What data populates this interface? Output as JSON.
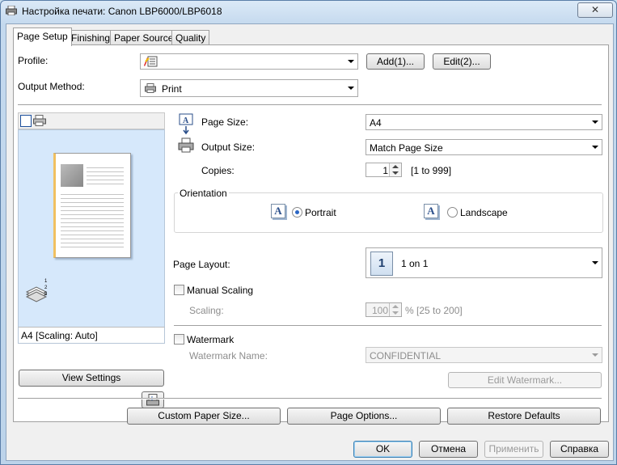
{
  "window": {
    "title": "Настройка печати: Canon LBP6000/LBP6018",
    "close_glyph": "✕"
  },
  "tabs": [
    "Page Setup",
    "Finishing",
    "Paper Source",
    "Quality"
  ],
  "profile": {
    "label": "Profile:",
    "value": "",
    "add_button": "Add(1)...",
    "edit_button": "Edit(2)..."
  },
  "output_method": {
    "label": "Output Method:",
    "value": "Print"
  },
  "preview": {
    "status": "A4 [Scaling: Auto]",
    "view_settings_button": "View Settings"
  },
  "page_size": {
    "label": "Page Size:",
    "value": "A4"
  },
  "output_size": {
    "label": "Output Size:",
    "value": "Match Page Size"
  },
  "copies": {
    "label": "Copies:",
    "value": "1",
    "range": "[1 to 999]"
  },
  "orientation": {
    "group_label": "Orientation",
    "portrait": "Portrait",
    "landscape": "Landscape",
    "selected": "Portrait",
    "icon_glyph": "A"
  },
  "page_layout": {
    "label": "Page Layout:",
    "value": "1 on 1",
    "icon_text": "1"
  },
  "manual_scaling": {
    "label": "Manual Scaling",
    "checked": false,
    "scaling_label": "Scaling:",
    "scaling_value": "100",
    "scaling_range": "% [25 to 200]"
  },
  "watermark": {
    "label": "Watermark",
    "checked": false,
    "name_label": "Watermark Name:",
    "name_value": "CONFIDENTIAL",
    "edit_button": "Edit Watermark..."
  },
  "bottom_buttons": {
    "custom_paper": "Custom Paper Size...",
    "page_options": "Page Options...",
    "restore_defaults": "Restore Defaults"
  },
  "dialog_buttons": {
    "ok": "OK",
    "cancel": "Отмена",
    "apply": "Применить",
    "help": "Справка"
  },
  "colors": {
    "preview_bg": "#d6e8fb",
    "radio_selected": "#2a66c5",
    "page_thumb_edge": "#f0c060"
  }
}
